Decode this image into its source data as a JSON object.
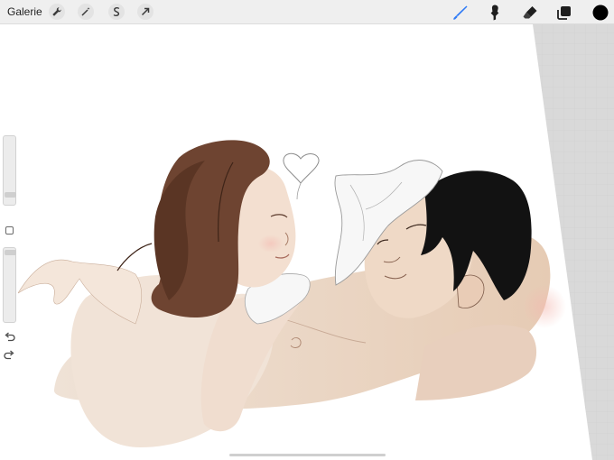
{
  "toolbar": {
    "gallery_label": "Galerie",
    "left_tools": [
      "wrench-icon",
      "magic-wand-icon",
      "selection-icon",
      "transform-arrow-icon"
    ],
    "right_tools": [
      "brush-icon",
      "smudge-icon",
      "eraser-icon",
      "layers-icon",
      "color-swatch"
    ],
    "active_tool": "brush-icon",
    "active_color": "#000000",
    "accent_color": "#2f7bf6"
  },
  "sidebar": {
    "controls": [
      "brush-size-slider",
      "modify-button",
      "opacity-slider",
      "undo-icon",
      "redo-icon"
    ]
  },
  "colors": {
    "canvas_bg": "#ffffff",
    "workspace_bg": "#d9d9d9",
    "skin": "#f0dccb",
    "hair_brown": "#6e4431",
    "hair_black": "#121212"
  }
}
